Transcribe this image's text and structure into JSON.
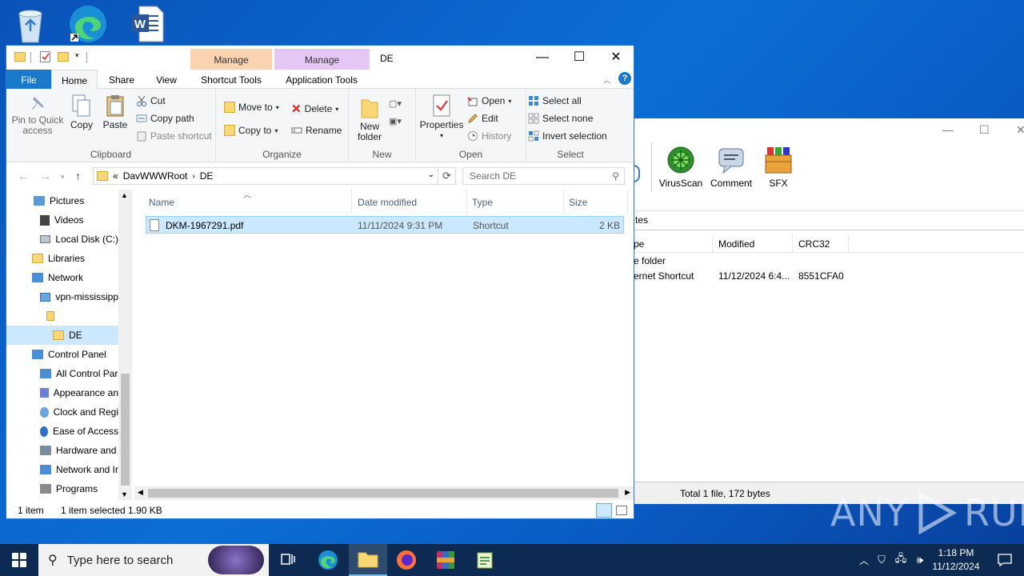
{
  "explorer": {
    "title": "DE",
    "contextual_tabs": {
      "manage1": "Manage",
      "shortcut_tools": "Shortcut Tools",
      "manage2": "Manage",
      "application_tools": "Application Tools"
    },
    "tabs": {
      "file": "File",
      "home": "Home",
      "share": "Share",
      "view": "View"
    },
    "ribbon": {
      "clipboard": {
        "label": "Clipboard",
        "pin": "Pin to Quick access",
        "copy": "Copy",
        "paste": "Paste",
        "cut": "Cut",
        "copy_path": "Copy path",
        "paste_shortcut": "Paste shortcut"
      },
      "organize": {
        "label": "Organize",
        "move_to": "Move to",
        "copy_to": "Copy to",
        "delete": "Delete",
        "rename": "Rename"
      },
      "new": {
        "label": "New",
        "new_folder": "New folder"
      },
      "open": {
        "label": "Open",
        "properties": "Properties",
        "open": "Open",
        "edit": "Edit",
        "history": "History"
      },
      "select": {
        "label": "Select",
        "select_all": "Select all",
        "select_none": "Select none",
        "invert": "Invert selection"
      }
    },
    "address": {
      "prefix": "«",
      "segments": [
        "DavWWWRoot",
        "DE"
      ],
      "search_placeholder": "Search DE"
    },
    "nav_items": [
      "Pictures",
      "Videos",
      "Local Disk (C:)",
      "Libraries",
      "Network",
      "vpn-mississipp",
      "",
      "DE",
      "Control Panel",
      "All Control Par",
      "Appearance an",
      "Clock and Regi",
      "Ease of Access",
      "Hardware and",
      "Network and Ir",
      "Programs"
    ],
    "columns": {
      "name": "Name",
      "date": "Date modified",
      "type": "Type",
      "size": "Size"
    },
    "files": [
      {
        "name": "DKM-1967291.pdf",
        "date": "11/11/2024 9:31 PM",
        "type": "Shortcut",
        "size": "2 KB"
      }
    ],
    "status": {
      "count": "1 item",
      "selected": "1 item selected  1.90 KB"
    }
  },
  "winrar": {
    "tools": [
      "VirusScan",
      "Comment",
      "SFX"
    ],
    "address_fragment": "tes",
    "columns": {
      "type": "pe",
      "modified": "Modified",
      "crc": "CRC32"
    },
    "rows": [
      {
        "type": "e folder",
        "modified": "",
        "crc": ""
      },
      {
        "type": "ernet Shortcut",
        "modified": "11/12/2024 6:4...",
        "crc": "8551CFA0"
      }
    ],
    "status": "Total 1 file, 172 bytes"
  },
  "taskbar": {
    "search_placeholder": "Type here to search",
    "time": "1:18 PM",
    "date": "11/12/2024"
  },
  "watermark": {
    "left": "ANY",
    "right": "RUN"
  }
}
